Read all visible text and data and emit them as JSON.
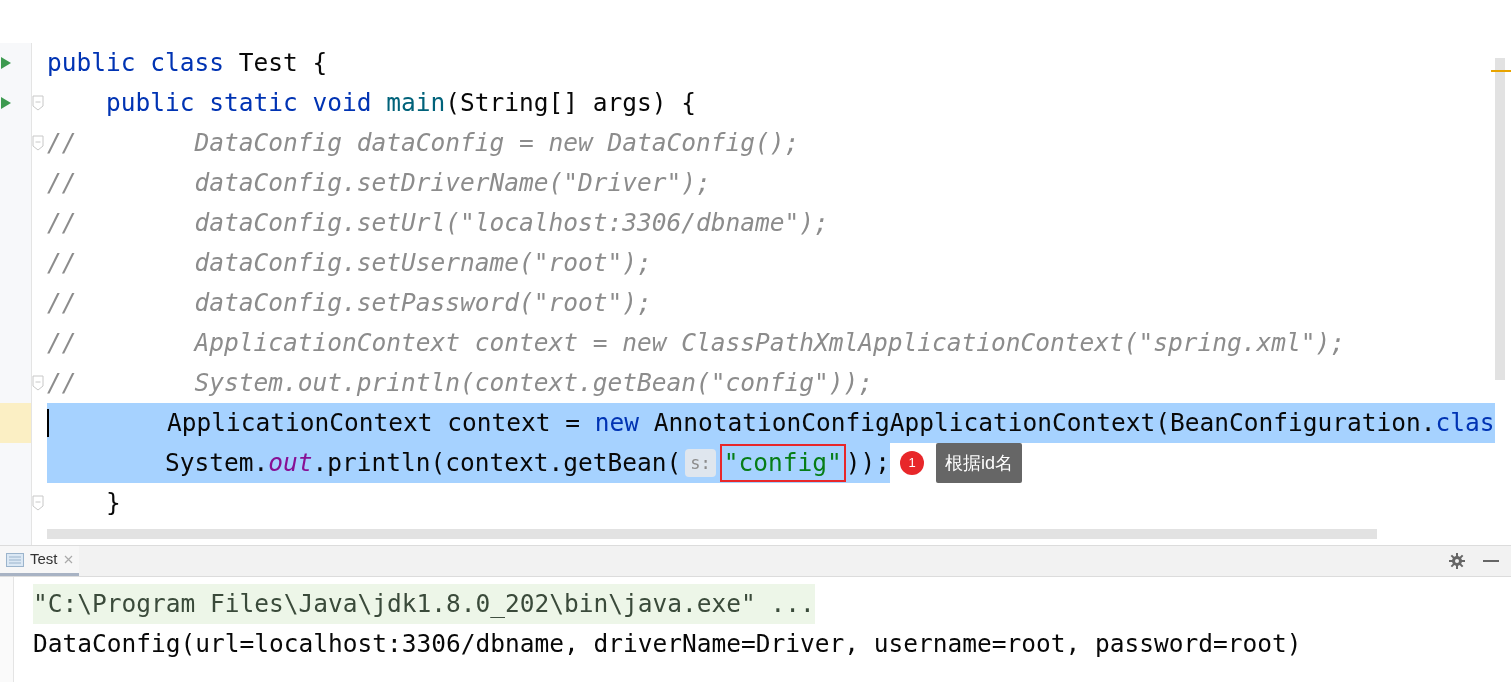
{
  "editor": {
    "lines": [
      {
        "run_marker": true,
        "fold_marker": false,
        "caret": false,
        "selected": false,
        "tokens": [
          {
            "kind": "keyword",
            "text": "public class "
          },
          {
            "kind": "plain",
            "text": "Test {"
          }
        ]
      },
      {
        "run_marker": true,
        "fold_marker": true,
        "caret": false,
        "selected": false,
        "tokens": [
          {
            "kind": "keyword",
            "text": "    public static void "
          },
          {
            "kind": "method",
            "text": "main"
          },
          {
            "kind": "plain",
            "text": "(String[] args) {"
          }
        ]
      },
      {
        "run_marker": false,
        "fold_marker": true,
        "caret": false,
        "selected": false,
        "tokens": [
          {
            "kind": "comment",
            "text": "//        DataConfig dataConfig = new DataConfig();"
          }
        ]
      },
      {
        "run_marker": false,
        "fold_marker": false,
        "caret": false,
        "selected": false,
        "tokens": [
          {
            "kind": "comment",
            "text": "//        dataConfig.setDriverName(\"Driver\");"
          }
        ]
      },
      {
        "run_marker": false,
        "fold_marker": false,
        "caret": false,
        "selected": false,
        "tokens": [
          {
            "kind": "comment",
            "text": "//        dataConfig.setUrl(\"localhost:3306/dbname\");"
          }
        ]
      },
      {
        "run_marker": false,
        "fold_marker": false,
        "caret": false,
        "selected": false,
        "tokens": [
          {
            "kind": "comment",
            "text": "//        dataConfig.setUsername(\"root\");"
          }
        ]
      },
      {
        "run_marker": false,
        "fold_marker": false,
        "caret": false,
        "selected": false,
        "tokens": [
          {
            "kind": "comment",
            "text": "//        dataConfig.setPassword(\"root\");"
          }
        ]
      },
      {
        "run_marker": false,
        "fold_marker": false,
        "caret": false,
        "selected": false,
        "tokens": [
          {
            "kind": "comment",
            "text": "//        ApplicationContext context = new ClassPathXmlApplicationContext(\"spring.xml\");"
          }
        ]
      },
      {
        "run_marker": false,
        "fold_marker": true,
        "caret": false,
        "selected": false,
        "tokens": [
          {
            "kind": "comment",
            "text": "//        System.out.println(context.getBean(\"config\"));"
          }
        ]
      },
      {
        "run_marker": false,
        "fold_marker": false,
        "caret": true,
        "selected": true,
        "tokens": [
          {
            "kind": "plain",
            "text": "        ApplicationContext context = "
          },
          {
            "kind": "keyword",
            "text": "new "
          },
          {
            "kind": "plain",
            "text": "AnnotationConfigApplicationContext(BeanConfiguration."
          },
          {
            "kind": "keyword",
            "text": "clas"
          }
        ]
      },
      {
        "run_marker": false,
        "fold_marker": false,
        "caret": false,
        "selected": true,
        "tokens": [
          {
            "kind": "plain",
            "text": "        System."
          },
          {
            "kind": "static_field",
            "text": "out"
          },
          {
            "kind": "plain",
            "text": ".println(context.getBean("
          },
          {
            "kind": "hint",
            "text": "s:"
          },
          {
            "kind": "string",
            "text": "\"config\"",
            "boxed": true
          },
          {
            "kind": "plain",
            "text": "));"
          }
        ],
        "callout": {
          "badge": "1",
          "text": "根据id名"
        }
      },
      {
        "run_marker": false,
        "fold_marker": true,
        "caret": false,
        "selected": false,
        "tokens": [
          {
            "kind": "plain",
            "text": "    }"
          }
        ]
      }
    ]
  },
  "run_panel": {
    "tab": {
      "label": "Test",
      "selected": true
    },
    "output": [
      {
        "kind": "command",
        "text": "\"C:\\Program Files\\Java\\jdk1.8.0_202\\bin\\java.exe\" ..."
      },
      {
        "kind": "stdout",
        "text": "DataConfig(url=localhost:3306/dbname, driverName=Driver, username=root, password=root)"
      }
    ]
  }
}
